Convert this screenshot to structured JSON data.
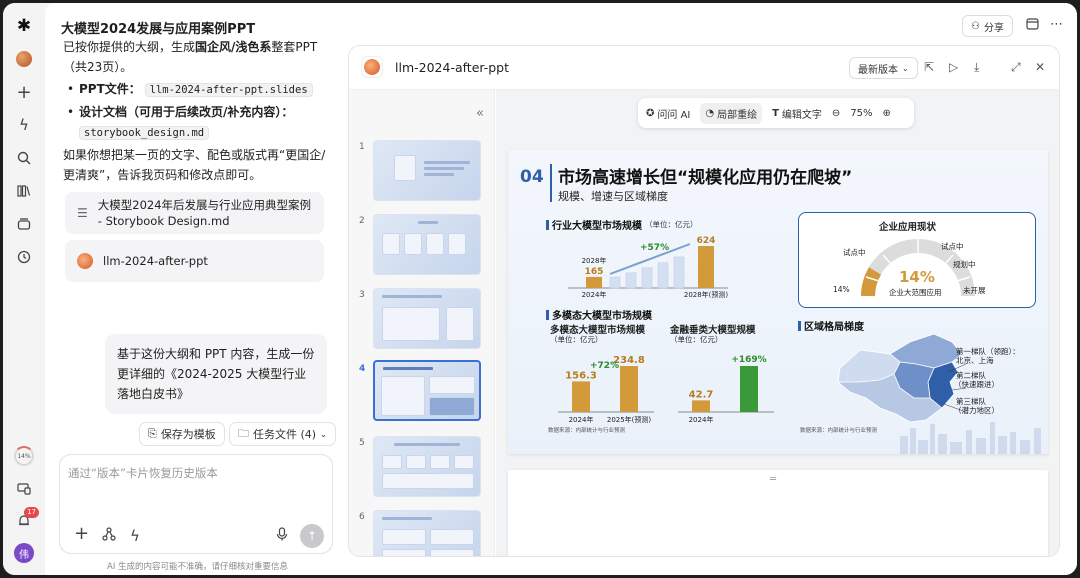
{
  "app": {
    "title": "大模型2024发展与应用案例PPT",
    "share_label": "分享"
  },
  "rail": {
    "progress": "14%",
    "notif_count": "17",
    "user_initial": "伟"
  },
  "chat": {
    "intro_line1": "已按你提供的大纲，生成",
    "intro_bold": "国企风/浅色系",
    "intro_line1b": "整套PPT",
    "intro_line2": "（共23页）。",
    "ppt_label": "PPT文件：",
    "ppt_file": "llm-2024-after-ppt.slides",
    "design_label": "设计文档（可用于后续改页/补充内容）：",
    "design_file": "storybook_design.md",
    "note": "如果你想把某一页的文字、配色或版式再“更国企/更清爽”，告诉我页码和修改点即可。",
    "card1": "大模型2024年后发展与行业应用典型案例 - Storybook Design.md",
    "card2": "llm-2024-after-ppt",
    "user_msg": "基于这份大纲和 PPT 内容，生成一份更详细的《2024-2025 大模型行业落地白皮书》",
    "save_template": "保存为模板",
    "task_files": "任务文件 (4)",
    "input_placeholder": "通过“版本”卡片恢复历史版本",
    "disclaimer": "AI 生成的内容可能不准确，请仔细核对重要信息"
  },
  "panel": {
    "title": "llm-2024-after-ppt",
    "version": "最新版本",
    "toolbar": {
      "ask_ai": "问问 AI",
      "redraw": "局部重绘",
      "edit_text": "编辑文字",
      "zoom": "75%"
    },
    "thumb_numbers": [
      "1",
      "2",
      "3",
      "4",
      "5",
      "6"
    ]
  },
  "slide": {
    "number": "04",
    "title": "市场高速增长但“规模化应用仍在爬坡”",
    "subtitle": "规模、增速与区域梯度",
    "sec_market": "行业大模型市场规模",
    "unit": "（单位：亿元）",
    "sec_multimodal": "多模态大模型市场规模",
    "sec_enterprise": "企业应用现状",
    "sec_region": "区域格局梯度",
    "source": "数据来源：内部统计与行业预测",
    "map_labels": {
      "tier1": "第一梯队（领跑）：",
      "tier1_places": "北京、上海",
      "tier2": "第二梯队",
      "tier2_sub": "（快速跟进）",
      "tier3": "第三梯队",
      "tier3_sub": "（潜力地区）"
    },
    "gauge": {
      "value": "14%",
      "caption": "企业大范围应用",
      "labels": [
        "试点中",
        "试点中",
        "规划中",
        "未开展",
        "14%"
      ]
    }
  },
  "chart_data": [
    {
      "type": "bar",
      "title": "行业大模型市场规模",
      "ylabel": "（单位：亿元）",
      "categories": [
        "2024年",
        "2028年(预测)"
      ],
      "values": [
        165,
        624
      ],
      "annotations": [
        "2028年",
        "+57%"
      ]
    },
    {
      "type": "bar",
      "title": "多模态大模型市场规模",
      "ylabel": "（单位：亿元）",
      "categories": [
        "2024年",
        "2025年(预测)"
      ],
      "values": [
        156.3,
        234.8
      ],
      "annotations": [
        "+72%"
      ]
    },
    {
      "type": "bar",
      "title": "金融垂类大模型规模",
      "ylabel": "（单位：亿元）",
      "categories": [
        "2024年",
        ""
      ],
      "values": [
        42.7,
        169
      ],
      "annotations": [
        "+169%"
      ]
    }
  ],
  "colors": {
    "accent": "#2e5fa8",
    "bar_gold": "#d39a3c",
    "bar_green": "#3a9a3a",
    "up_green": "#2d8a2d"
  }
}
